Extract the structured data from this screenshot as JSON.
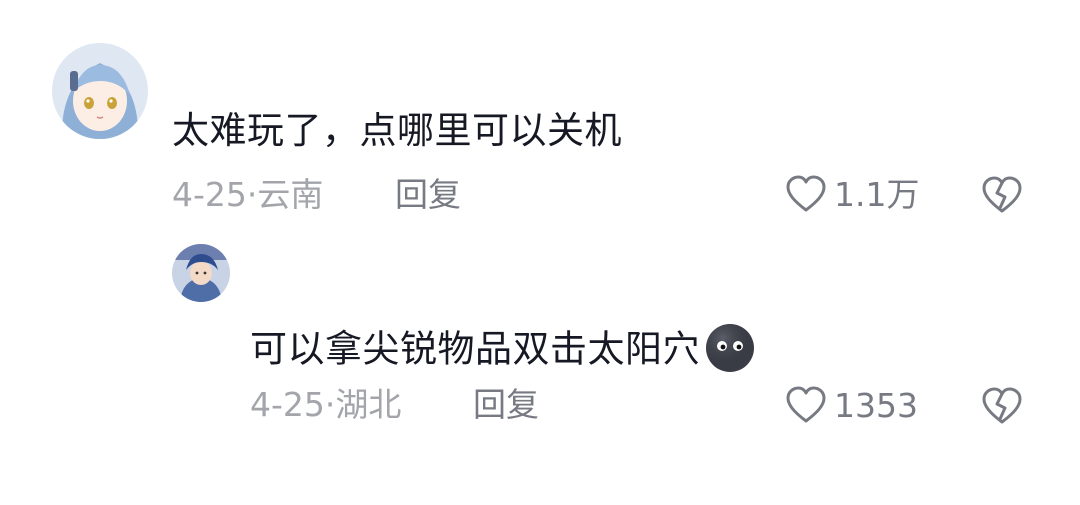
{
  "comments": [
    {
      "text": "太难玩了，点哪里可以关机",
      "date": "4-25·",
      "location": "云南",
      "reply_label": "回复",
      "like_count": "1.1万"
    },
    {
      "text": "可以拿尖锐物品双击太阳穴",
      "date": "4-25·",
      "location": "湖北",
      "reply_label": "回复",
      "like_count": "1353",
      "emoji": "dark-moon-face"
    }
  ],
  "colors": {
    "text": "#161823",
    "meta": "#a3a5ab",
    "action": "#777a82"
  }
}
